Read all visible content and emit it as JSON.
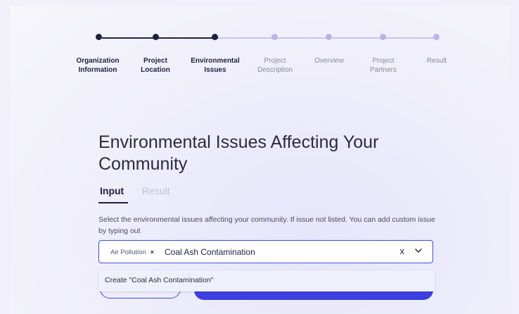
{
  "stepper": {
    "steps": [
      {
        "label": "Organization\nInformation",
        "status": "done"
      },
      {
        "label": "Project\nLocation",
        "status": "done"
      },
      {
        "label": "Environmental\nIssues",
        "status": "current"
      },
      {
        "label": "Project\nDescription",
        "status": "todo"
      },
      {
        "label": "Overview",
        "status": "todo"
      },
      {
        "label": "Project\nPartners",
        "status": "todo"
      },
      {
        "label": "Result",
        "status": "todo"
      }
    ],
    "colors": {
      "done": "#1d2140",
      "todo": "#b9b5e6"
    }
  },
  "page": {
    "title": "Environmental Issues Affecting Your Community"
  },
  "tabs": {
    "input_label": "Input",
    "result_label": "Result"
  },
  "form": {
    "help_text": "Select the environmental issues affecting your community. If issue not listed. You can add custom issue by typing out",
    "selected_chip": "Air Pollution",
    "chip_remove": "×",
    "input_value": "Coal Ash Contamination",
    "clear_symbol": "x",
    "dropdown_option": "Create \"Coal Ash Contamination\""
  },
  "colors": {
    "accent": "#3c3fe0",
    "border": "#3b4fd8",
    "text_dark": "#1d2140"
  }
}
